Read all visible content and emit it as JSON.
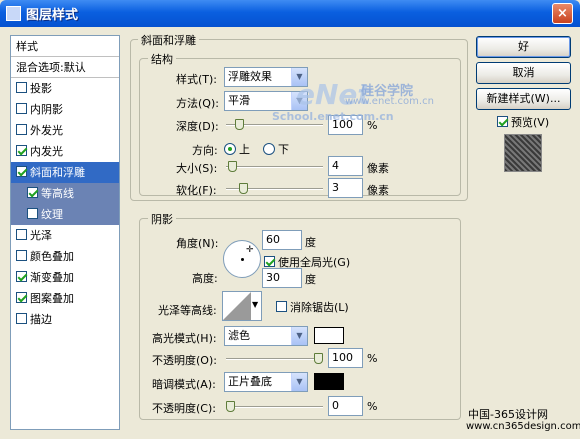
{
  "window": {
    "title": "图层样式",
    "close": "×"
  },
  "left_list": {
    "header": "样式",
    "blend": "混合选项:默认",
    "items": [
      {
        "label": "投影",
        "checked": false
      },
      {
        "label": "内阴影",
        "checked": false
      },
      {
        "label": "外发光",
        "checked": false
      },
      {
        "label": "内发光",
        "checked": true
      },
      {
        "label": "斜面和浮雕",
        "checked": true,
        "selected": true
      },
      {
        "label": "等高线",
        "checked": true,
        "sub": true
      },
      {
        "label": "纹理",
        "checked": false,
        "sub": true
      },
      {
        "label": "光泽",
        "checked": false
      },
      {
        "label": "颜色叠加",
        "checked": false
      },
      {
        "label": "渐变叠加",
        "checked": true
      },
      {
        "label": "图案叠加",
        "checked": true
      },
      {
        "label": "描边",
        "checked": false
      }
    ]
  },
  "bevel": {
    "group_title": "斜面和浮雕",
    "structure_title": "结构",
    "style_label": "样式(T):",
    "style_value": "浮雕效果",
    "method_label": "方法(Q):",
    "method_value": "平滑",
    "depth_label": "深度(D):",
    "depth_value": "100",
    "depth_unit": "%",
    "depth_level": 0.1,
    "direction_label": "方向:",
    "dir_up": "上",
    "dir_down": "下",
    "size_label": "大小(S):",
    "size_value": "4",
    "size_unit": "像素",
    "size_level": 0.02,
    "soften_label": "软化(F):",
    "soften_value": "3",
    "soften_unit": "像素",
    "soften_level": 0.15
  },
  "shading": {
    "title": "阴影",
    "angle_label": "角度(N):",
    "angle_value": "60",
    "angle_unit": "度",
    "global_light_label": "使用全局光(G)",
    "global_light_checked": true,
    "altitude_label": "高度:",
    "altitude_value": "30",
    "altitude_unit": "度",
    "gloss_label": "光泽等高线:",
    "antialias_label": "消除锯齿(L)",
    "antialias_checked": false,
    "highlight_label": "高光模式(H):",
    "highlight_mode": "滤色",
    "highlight_color": "#ffffff",
    "hl_opacity_label": "不透明度(O):",
    "hl_opacity_value": "100",
    "hl_opacity_unit": "%",
    "hl_opacity_level": 1.0,
    "shadow_label": "暗调模式(A):",
    "shadow_mode": "正片叠底",
    "shadow_color": "#000000",
    "sh_opacity_label": "不透明度(C):",
    "sh_opacity_value": "0",
    "sh_opacity_unit": "%",
    "sh_opacity_level": 0.0
  },
  "buttons": {
    "ok": "好",
    "cancel": "取消",
    "new_style": "新建样式(W)...",
    "preview": "预览(V)",
    "preview_checked": true
  },
  "watermark": {
    "brand": "硅谷学院",
    "site": "www.enet.com.cn",
    "school": "School.enet.com.cn",
    "footer1": "中国-365设计网",
    "footer2": "www.cn365design.com"
  }
}
